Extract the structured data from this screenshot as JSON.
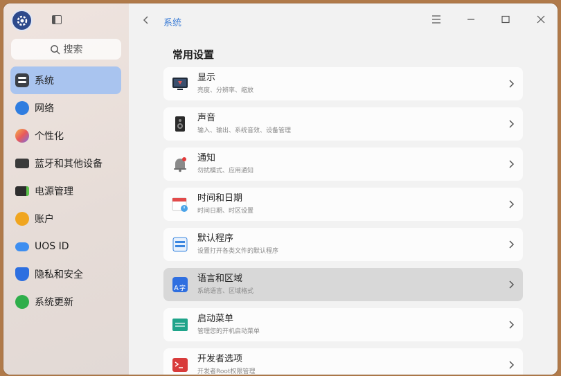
{
  "app": {
    "logo_icon": "settings-gear-icon"
  },
  "search": {
    "placeholder": "搜索"
  },
  "sidebar": {
    "items": [
      {
        "label": "系统",
        "icon": "system-icon",
        "active": true
      },
      {
        "label": "网络",
        "icon": "network-icon"
      },
      {
        "label": "个性化",
        "icon": "personalization-icon"
      },
      {
        "label": "蓝牙和其他设备",
        "icon": "bluetooth-devices-icon"
      },
      {
        "label": "电源管理",
        "icon": "power-icon"
      },
      {
        "label": "账户",
        "icon": "account-icon"
      },
      {
        "label": "UOS ID",
        "icon": "cloud-icon"
      },
      {
        "label": "隐私和安全",
        "icon": "privacy-shield-icon"
      },
      {
        "label": "系统更新",
        "icon": "update-icon"
      }
    ]
  },
  "header": {
    "breadcrumb": "系统"
  },
  "main": {
    "section_title": "常用设置",
    "items": [
      {
        "title": "显示",
        "subtitle": "亮度、分辨率、缩放",
        "icon": "display-icon"
      },
      {
        "title": "声音",
        "subtitle": "输入、输出、系统音效、设备管理",
        "icon": "speaker-icon"
      },
      {
        "title": "通知",
        "subtitle": "勿扰模式、应用通知",
        "icon": "bell-icon"
      },
      {
        "title": "时间和日期",
        "subtitle": "时间日期、时区设置",
        "icon": "calendar-icon"
      },
      {
        "title": "默认程序",
        "subtitle": "设置打开各类文件的默认程序",
        "icon": "default-apps-icon"
      },
      {
        "title": "语言和区域",
        "subtitle": "系统语言、区域格式",
        "icon": "language-icon",
        "highlighted": true
      },
      {
        "title": "启动菜单",
        "subtitle": "管理您的开机启动菜单",
        "icon": "boot-menu-icon"
      },
      {
        "title": "开发者选项",
        "subtitle": "开发者Root权限管理",
        "icon": "terminal-icon"
      }
    ]
  }
}
